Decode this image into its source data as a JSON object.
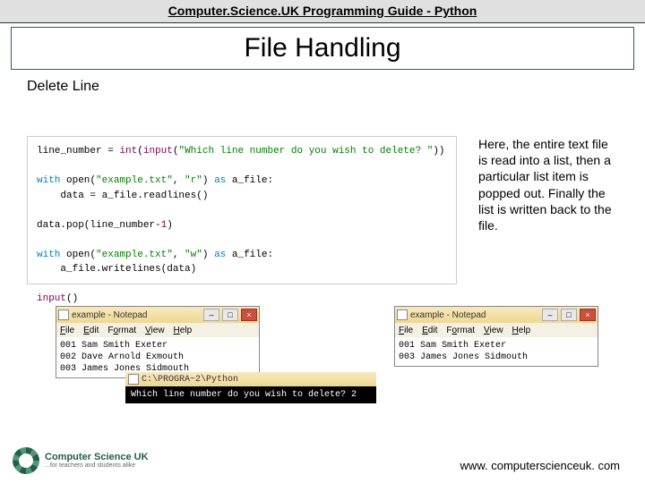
{
  "header": {
    "site_title": "Computer.Science.UK Programming Guide - Python"
  },
  "page": {
    "main_title": "File Handling",
    "section_heading": "Delete Line"
  },
  "code": {
    "l1a": "line_number = ",
    "l1b": "int",
    "l1c": "(",
    "l1d": "input",
    "l1e": "(",
    "l1f": "\"Which line number do you wish to delete? \"",
    "l1g": "))",
    "l3a": "with",
    "l3b": " open(",
    "l3c": "\"example.txt\"",
    "l3d": ", ",
    "l3e": "\"r\"",
    "l3f": ") ",
    "l3g": "as",
    "l3h": " a_file:",
    "l4": "    data = a_file.readlines()",
    "l6a": "data.pop(line_number-",
    "l6b": "1",
    "l6c": ")",
    "l8a": "with",
    "l8b": " open(",
    "l8c": "\"example.txt\"",
    "l8d": ", ",
    "l8e": "\"w\"",
    "l8f": ") ",
    "l8g": "as",
    "l8h": " a_file:",
    "l9": "    a_file.writelines(data)",
    "l11a": "input",
    "l11b": "()"
  },
  "description": "Here, the entire text file is read into a list, then a particular list item is popped out. Finally the list is written back to the file.",
  "notepad_before": {
    "title": "example - Notepad",
    "menu": {
      "file": "File",
      "edit": "Edit",
      "format": "Format",
      "view": "View",
      "help": "Help"
    },
    "lines": [
      "001 Sam Smith Exeter",
      "002 Dave Arnold Exmouth",
      "003 James Jones Sidmouth"
    ]
  },
  "notepad_after": {
    "title": "example - Notepad",
    "menu": {
      "file": "File",
      "edit": "Edit",
      "format": "Format",
      "view": "View",
      "help": "Help"
    },
    "lines": [
      "001 Sam Smith Exeter",
      "003 James Jones Sidmouth"
    ]
  },
  "terminal": {
    "title_path": "C:\\PROGRA~2\\Python",
    "prompt_line": "Which line number do you wish to delete? 2"
  },
  "footer": {
    "url": "www. computerscienceuk. com"
  },
  "logo": {
    "brand": "Computer Science UK",
    "tagline": "...for teachers and students alike"
  },
  "window_controls": {
    "min": "–",
    "max": "□",
    "close": "×"
  }
}
